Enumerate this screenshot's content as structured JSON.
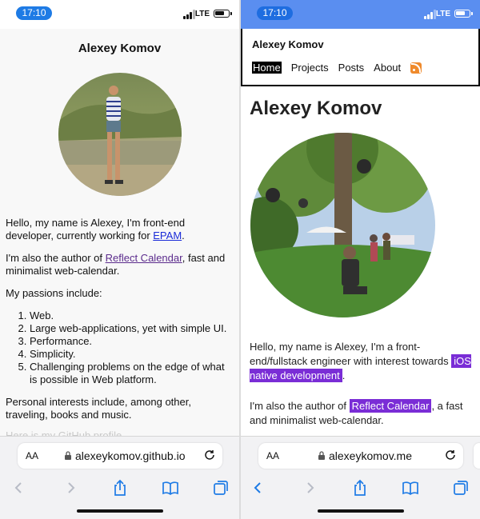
{
  "left": {
    "status_time": "17:10",
    "status_network": "LTE",
    "site_title": "Alexey Komov",
    "intro": {
      "prefix": "Hello, my name is Alexey, I'm front-end developer, currently working for ",
      "link": "EPAM",
      "suffix": "."
    },
    "author": {
      "prefix": "I'm also the author of ",
      "link": "Reflect Calendar",
      "suffix": ", fast and minimalist web-calendar."
    },
    "passions_heading": "My passions include:",
    "passions": [
      "Web.",
      "Large web-applications, yet with simple UI.",
      "Performance.",
      "Simplicity.",
      "Challenging problems on the edge of what is possible in Web platform."
    ],
    "interests": "Personal interests include, among other, traveling, books and music.",
    "cut_text": "Here is my GitHub profile",
    "browser": {
      "aa_label": "AA",
      "url": "alexeykomov.github.io"
    }
  },
  "right": {
    "status_time": "17:10",
    "status_network": "LTE",
    "site_name": "Alexey Komov",
    "nav": [
      "Home",
      "Projects",
      "Posts",
      "About"
    ],
    "page_title": "Alexey Komov",
    "intro": {
      "prefix": "Hello, my name is Alexey, I'm a front-end/fullstack engineer with interest towards ",
      "link": "iOS native development",
      "suffix": "."
    },
    "author": {
      "prefix": "I'm also the author of ",
      "link": "Reflect Calendar",
      "suffix": ", a fast and minimalist web-calendar."
    },
    "browser": {
      "aa_label": "AA",
      "url": "alexeykomov.me"
    }
  },
  "colors": {
    "left_link_blue": "#1a2bd8",
    "left_link_purple": "#5b2b8c",
    "right_highlight": "#7a2dd6",
    "right_status_bar": "#5a8ef0",
    "rss": "#ef8a2c",
    "safari_tint": "#1e7be5"
  }
}
